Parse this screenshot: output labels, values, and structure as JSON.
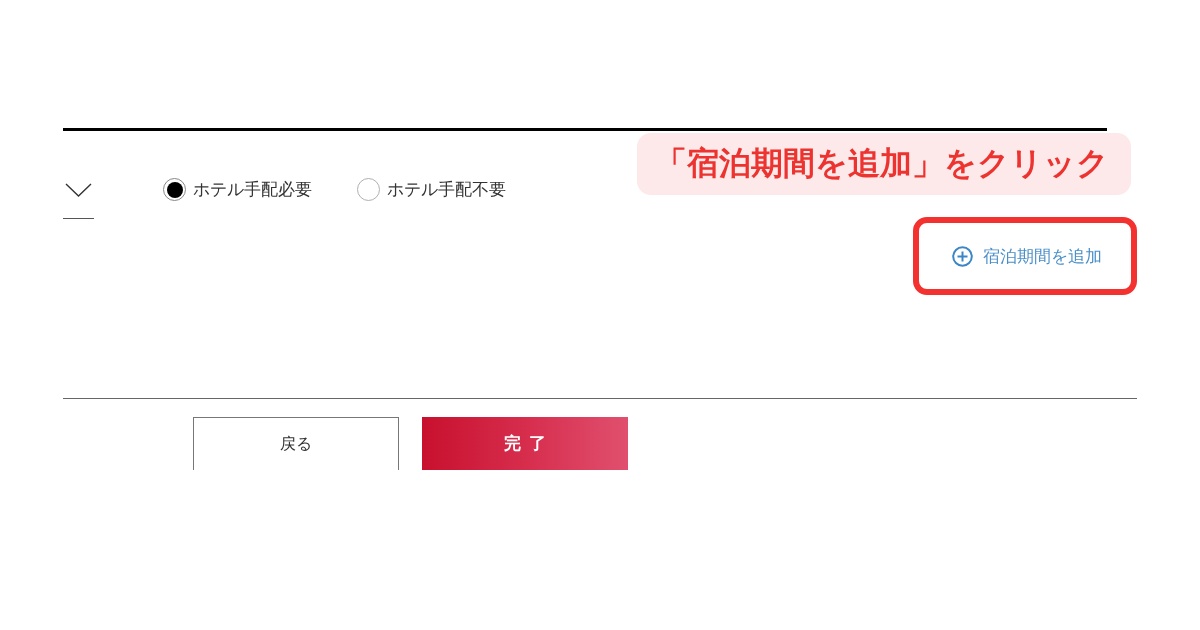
{
  "section": {
    "hotel_options": [
      {
        "label": "ホテル手配必要",
        "selected": true
      },
      {
        "label": "ホテル手配不要",
        "selected": false
      }
    ],
    "add_stay_link": {
      "label": "宿泊期間を追加"
    }
  },
  "annotation": {
    "callout": "「宿泊期間を追加」をクリック"
  },
  "buttons": [
    {
      "label": "戻る",
      "kind": "secondary"
    },
    {
      "label": "完了",
      "kind": "primary"
    }
  ]
}
